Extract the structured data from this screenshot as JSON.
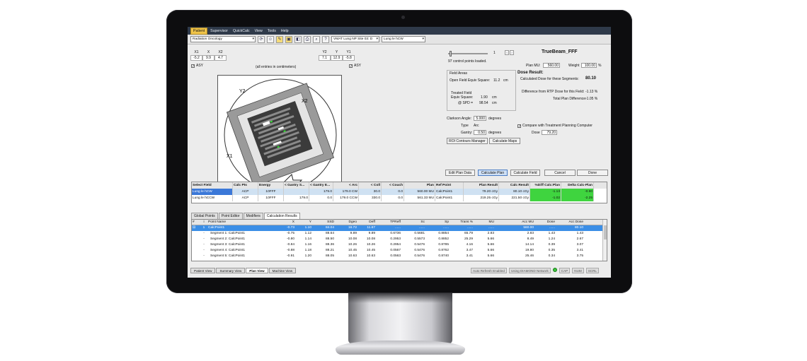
{
  "menu": [
    "Patient",
    "Supervisor",
    "QuickCalc",
    "View",
    "Tools",
    "Help"
  ],
  "toolbar": {
    "department": "Radiation Oncology",
    "plan": "VMAT Lung NP Site 03: D",
    "field": "Lung le hCW"
  },
  "jaws_left": {
    "labels": [
      "X1",
      "X",
      "X2"
    ],
    "values": [
      "-5.2",
      "9.9",
      "4.7"
    ]
  },
  "jaws_right": {
    "labels": [
      "Y2",
      "Y",
      "Y1"
    ],
    "values": [
      "7.1",
      "12.9",
      "-5.8"
    ]
  },
  "asy_label": "ASY",
  "units_note": "(all entries in centimeters)",
  "bev_labels": {
    "y2": "Y2",
    "x2": "X2",
    "x1": "X1"
  },
  "control_points": {
    "value": "1",
    "loaded": "97 control points loaded."
  },
  "machine": "TrueBeam_FFF",
  "plan_mu": {
    "label": "Plan MU:",
    "value": "560.00"
  },
  "weight": {
    "label": "Weight",
    "value": "100.00",
    "unit": "%"
  },
  "dose_result": {
    "title": "Dose Result:",
    "calc_label": "Calculated Dose for these Segments:",
    "calc_value": "80.10",
    "diff_label": "Difference from RTP Dose for this Field:",
    "diff_value": "-1.13 %",
    "total_label": "Total Plan Difference:",
    "total_value": "-1.05 %"
  },
  "field_areas": {
    "title": "Field Areas",
    "open_label": "Open Field Equiv Square:",
    "open_value": "11.2",
    "open_unit": "cm",
    "treated_label1": "Treated Field",
    "treated_label2": "Equiv Square:",
    "treated_value": "1.90",
    "treated_unit": "cm",
    "ssd_label": "@ SPD =",
    "ssd_value": "98.54",
    "ssd_unit": "cm"
  },
  "clarkson": {
    "label": "Clarkson Angle:",
    "value": "5.000",
    "unit": "degrees"
  },
  "type": {
    "label": "Type",
    "value": "Arc"
  },
  "gantry": {
    "label": "Gantry:",
    "value": "0.50",
    "unit": "degrees"
  },
  "compare": {
    "label": "Compare with Treatment Planning Computer",
    "dose_label": "Dose",
    "dose_value": "79.20"
  },
  "buttons": {
    "roi": "ROI Contours Manager",
    "maps": "Calculate Maps",
    "edit": "Edit Plan Data",
    "calc_plan": "Calculate Plan",
    "calc_field": "Calculate Field",
    "cancel": "Cancel",
    "done": "Done"
  },
  "field_table": {
    "headers": [
      "Select Field",
      "Calc Pts",
      "Energy",
      "< Gantry S...",
      "< Gantry E...",
      "< Arc",
      "< Coll",
      "< Couch",
      "Plan",
      "Ref Point",
      "Plan Result",
      "Calc Result",
      "%Diff Calc:Plan",
      "Delta Calc-Plan"
    ],
    "rows": [
      [
        "Lung le hCW",
        "ACP",
        "10FFF",
        "",
        "179.0",
        "179.0 CW",
        "30.0",
        "0.0",
        "560.00 MU",
        "CalcPoint1",
        "79.20 cGy",
        "80.10 cGy",
        "-1.13",
        "-0.90"
      ],
      [
        "Lung le hCCW",
        "ACP",
        "10FFF",
        "179.0",
        "0.0",
        "179.0 CCW",
        "330.0",
        "0.0",
        "561.33 MU",
        "CalcPoint1",
        "219.25 cGy",
        "221.50 cGy",
        "-1.02",
        "-2.25"
      ]
    ]
  },
  "lower_tabs": [
    "Global Points",
    "Point Editor",
    "Modifiers",
    "Calculation Results"
  ],
  "results": {
    "headers": [
      "#",
      "i",
      "Point Name",
      "X",
      "Y",
      "SSD",
      "Dgeo",
      "Deff",
      "TPReff",
      "Sc",
      "Sp",
      "Trans %",
      "MU",
      "Acc MU",
      "Dose",
      "Acc Dose"
    ],
    "rows": [
      [
        "⊟",
        "1",
        "CalcPoint1",
        "-0.73",
        "1.10",
        "84.04",
        "16.72",
        "11.67",
        "......",
        "......",
        "......",
        "......",
        "......",
        "560.00",
        "......",
        "80.10"
      ],
      [
        "",
        "-",
        "Segment 1: CalcPoint1",
        "-0.75",
        "1.12",
        "88.64",
        "9.89",
        "9.89",
        "0.6736",
        "0.5681",
        "0.8854",
        "65.79",
        "2.83",
        "2.83",
        "1.43",
        "1.43"
      ],
      [
        "",
        "-",
        "Segment 2: CalcPoint1",
        "-0.80",
        "1.14",
        "88.50",
        "10.08",
        "10.08",
        "0.2953",
        "0.5573",
        "0.8852",
        "25.29",
        "5.66",
        "8.49",
        "1.24",
        "2.67"
      ],
      [
        "",
        "-",
        "Segment 3: CalcPoint1",
        "-0.84",
        "1.16",
        "88.36",
        "10.26",
        "10.26",
        "0.2954",
        "0.5476",
        "0.8785",
        "4.16",
        "5.66",
        "14.14",
        "0.39",
        "3.07"
      ],
      [
        "",
        "-",
        "Segment 4: CalcPoint1",
        "-0.88",
        "1.18",
        "88.21",
        "10.45",
        "10.45",
        "0.0567",
        "0.5476",
        "0.8762",
        "3.47",
        "5.66",
        "19.80",
        "0.35",
        "3.41"
      ],
      [
        "",
        "-",
        "Segment 5: CalcPoint1",
        "-0.91",
        "1.20",
        "88.05",
        "10.63",
        "10.63",
        "0.0563",
        "0.5476",
        "0.8740",
        "3.41",
        "5.66",
        "25.46",
        "0.34",
        "3.75"
      ]
    ]
  },
  "bottom_tabs": [
    "Patient View",
    "Summary View",
    "Plan View",
    "Machine View"
  ],
  "status": {
    "refresh": "Auto Refresh Enabled",
    "network": "Using DIAMOND Network",
    "cap": "CAP",
    "num": "NUM",
    "scrl": "SCRL"
  }
}
